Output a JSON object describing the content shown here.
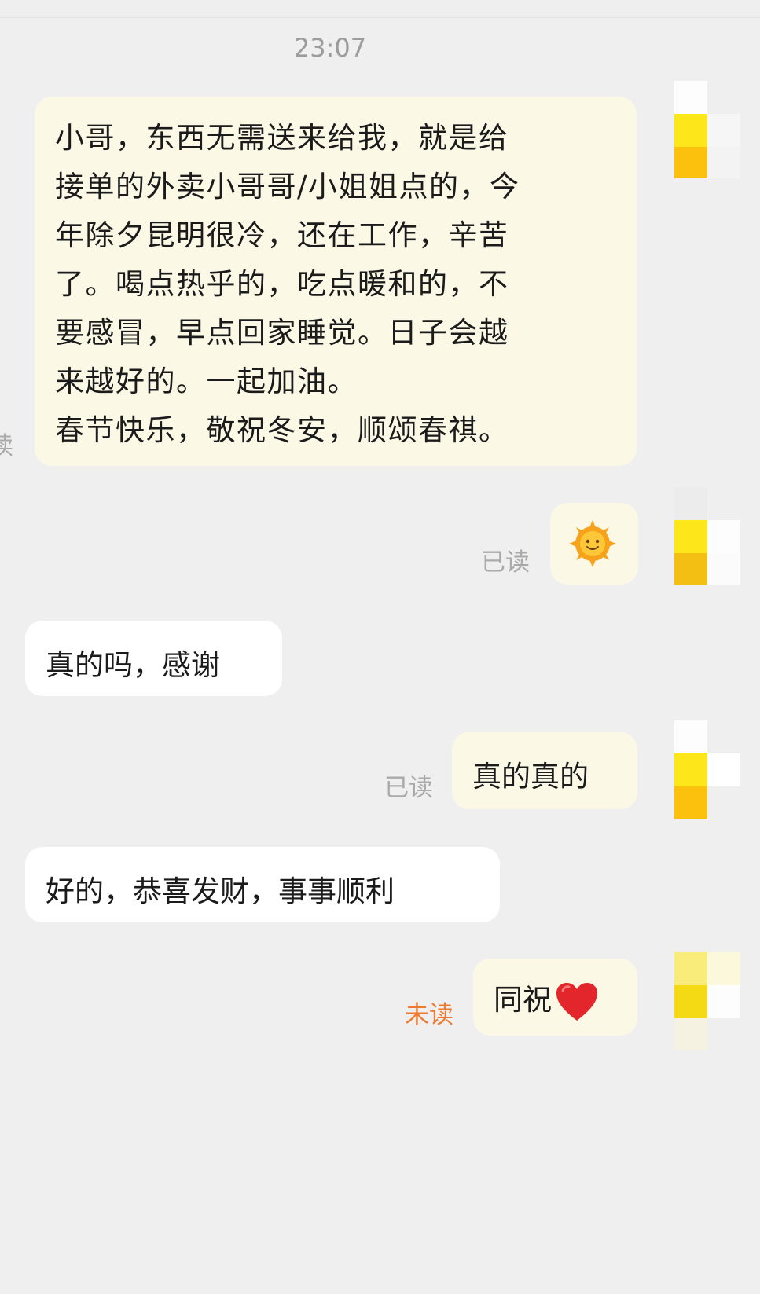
{
  "chat": {
    "timestamp": "23:07",
    "messages": [
      {
        "text": "小哥，东西无需送来给我，就是给\n接单的外卖小哥哥/小姐姐点的，今\n年除夕昆明很冷，还在工作，辛苦\n了。喝点热乎的，吃点暖和的，不\n要感冒，早点回家睡觉。日子会越\n来越好的。一起加油。\n春节快乐，敬祝冬安，顺颂春祺。",
        "status_fragment": "读"
      },
      {
        "icon": "sun-emoji-icon",
        "status": "已读"
      },
      {
        "text": "真的吗，感谢"
      },
      {
        "text": "真的真的",
        "status": "已读"
      },
      {
        "text": "好的，恭喜发财，事事顺利"
      },
      {
        "text": "同祝",
        "icon": "red-heart-emoji-icon",
        "status": "未读"
      }
    ]
  },
  "colors": {
    "background": "#efefef",
    "my_bubble": "#fbf8e6",
    "other_bubble": "#ffffff",
    "read_status": "#aaaaaa",
    "unread_status": "#ee7a2f",
    "avatar_yellow": "#fde61a",
    "avatar_orange": "#fbc10d"
  }
}
